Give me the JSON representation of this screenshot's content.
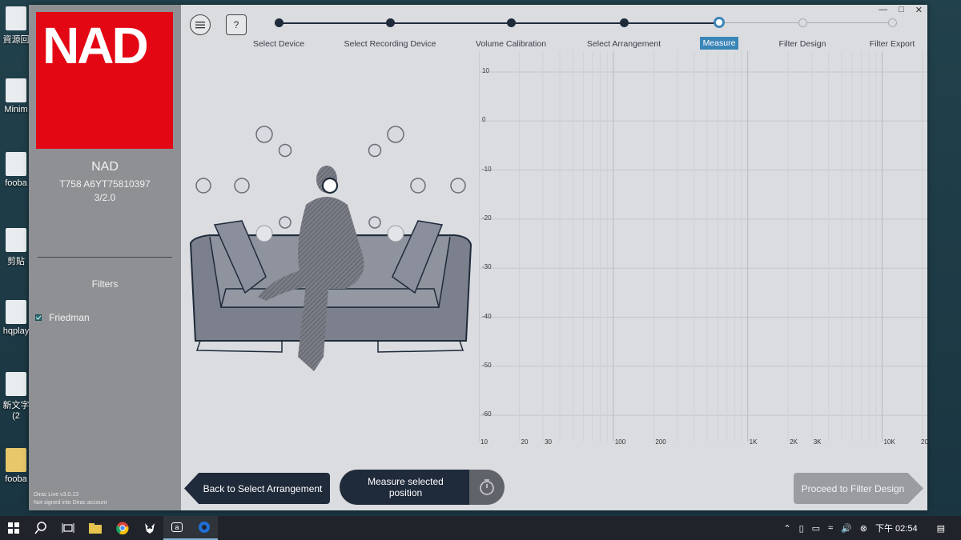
{
  "desktop": {
    "icons": [
      {
        "label": "資源回"
      },
      {
        "label": "Minim"
      },
      {
        "label": "fooba"
      },
      {
        "label": "剪貼"
      },
      {
        "label": "hqplay"
      },
      {
        "label": "新文字"
      },
      {
        "label": "(2"
      },
      {
        "label": "fooba"
      }
    ]
  },
  "sidebar": {
    "logo_text": "NAD",
    "device_name": "NAD",
    "device_serial": "T758 A6YT75810397",
    "device_channels": "3/2.0",
    "filters_title": "Filters",
    "filters": [
      {
        "label": "Friedman",
        "checked": true
      }
    ],
    "version_line1": "Dirac Live v3.0.13",
    "version_line2": "Not signed into Dirac account"
  },
  "toolbar": {
    "menu_icon": "menu-icon",
    "help_label": "?"
  },
  "steps": [
    {
      "label": "Select Device",
      "state": "done"
    },
    {
      "label": "Select Recording Device",
      "state": "done"
    },
    {
      "label": "Volume Calibration",
      "state": "done"
    },
    {
      "label": "Select Arrangement",
      "state": "done"
    },
    {
      "label": "Measure",
      "state": "current"
    },
    {
      "label": "Filter Design",
      "state": "future"
    },
    {
      "label": "Filter Export",
      "state": "future"
    }
  ],
  "graph": {
    "y_ticks": [
      "10",
      "0",
      "-10",
      "-20",
      "-30",
      "-40",
      "-50",
      "-60"
    ],
    "x_ticks": [
      "10",
      "20",
      "30",
      "100",
      "200",
      "1K",
      "2K",
      "3K",
      "10K",
      "20"
    ]
  },
  "buttons": {
    "back_label": "Back to Select Arrangement",
    "measure_label_1": "Measure selected",
    "measure_label_2": "position",
    "proceed_label": "Proceed to Filter Design"
  },
  "taskbar": {
    "clock": "下午 02:54",
    "ime": "a"
  },
  "colors": {
    "accent": "#3b86b8",
    "nav": "#1f2a3a",
    "brand": "#e30613"
  }
}
